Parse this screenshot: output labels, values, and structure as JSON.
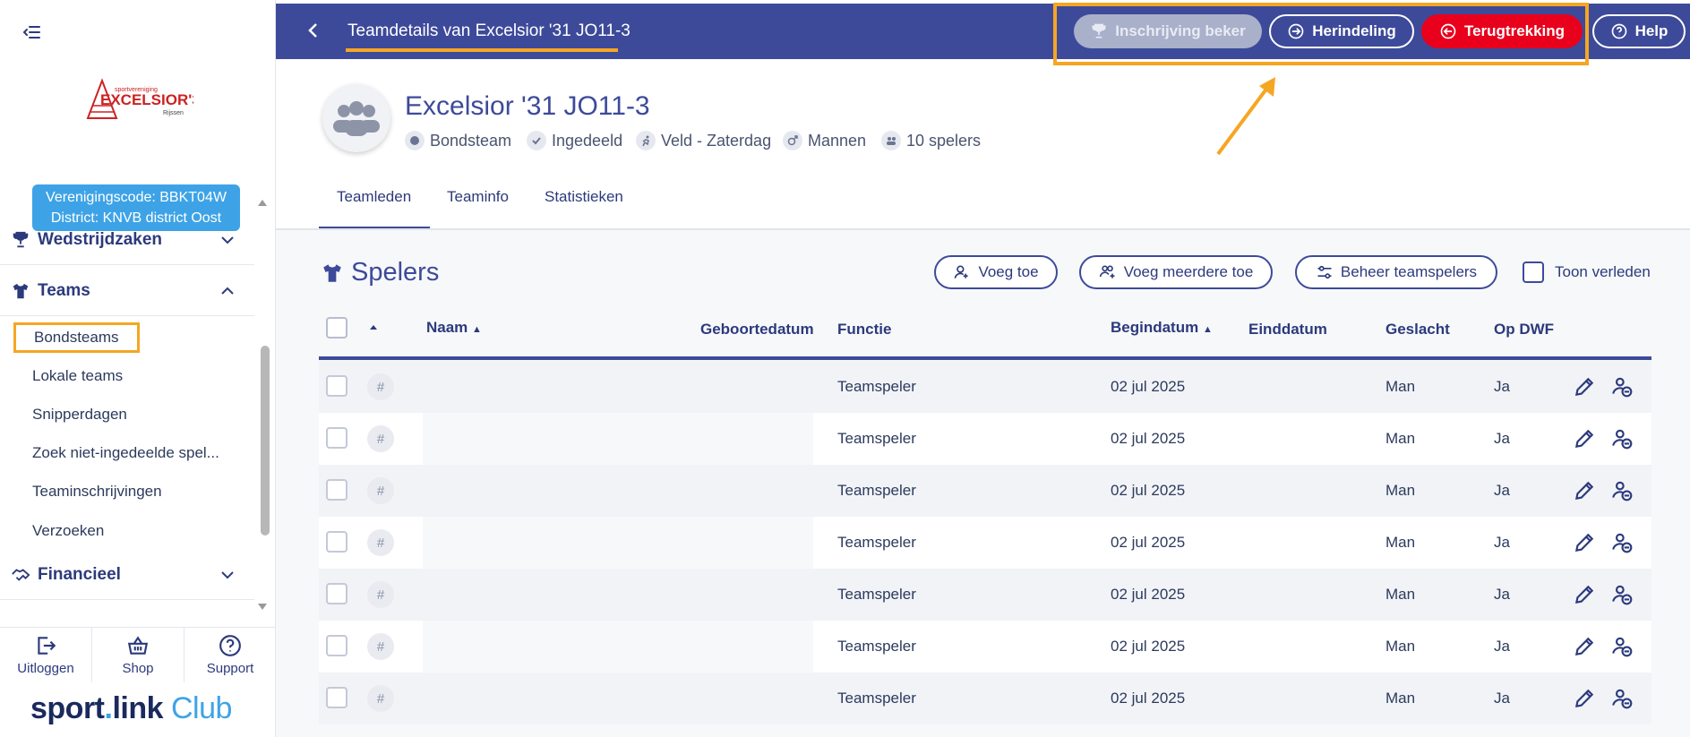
{
  "sidebar": {
    "club_code": "Verenigingscode: BBKT04W",
    "club_district": "District: KNVB district Oost",
    "logo_text": "EXCELSIOR'31",
    "sections": [
      {
        "label": "Wedstrijdzaken",
        "icon": "trophy-icon",
        "expanded": false
      },
      {
        "label": "Teams",
        "icon": "shirt-icon",
        "expanded": true
      },
      {
        "label": "Financieel",
        "icon": "handshake-icon",
        "expanded": false
      }
    ],
    "team_items": [
      "Bondsteams",
      "Lokale teams",
      "Snipperdagen",
      "Zoek niet-ingedeelde spel...",
      "Teaminschrijvingen",
      "Verzoeken"
    ],
    "active_item": "Bondsteams",
    "bottom": {
      "logout": "Uitloggen",
      "shop": "Shop",
      "support": "Support"
    },
    "brand": {
      "sport": "sport",
      "dot": ".",
      "link": "link",
      "club": "Club"
    }
  },
  "header": {
    "title": "Teamdetails van Excelsior '31 JO11-3",
    "buttons": {
      "beker": "Inschrijving beker",
      "herindeling": "Herindeling",
      "terugtrekking": "Terugtrekking",
      "help": "Help"
    }
  },
  "team": {
    "name": "Excelsior '31 JO11-3",
    "meta": [
      "Bondsteam",
      "Ingedeeld",
      "Veld - Zaterdag",
      "Mannen",
      "10 spelers"
    ]
  },
  "tabs": [
    "Teamleden",
    "Teaminfo",
    "Statistieken"
  ],
  "spelers": {
    "title": "Spelers",
    "add": "Voeg toe",
    "add_multiple": "Voeg meerdere toe",
    "manage": "Beheer teamspelers",
    "toon_verleden": "Toon verleden"
  },
  "table": {
    "columns": [
      "Naam",
      "Geboortedatum",
      "Functie",
      "Begindatum",
      "Einddatum",
      "Geslacht",
      "Op DWF"
    ],
    "rows": [
      {
        "hash": "#",
        "functie": "Teamspeler",
        "begindatum": "02 jul 2025",
        "einddatum": "",
        "geslacht": "Man",
        "dwf": "Ja"
      },
      {
        "hash": "#",
        "functie": "Teamspeler",
        "begindatum": "02 jul 2025",
        "einddatum": "",
        "geslacht": "Man",
        "dwf": "Ja"
      },
      {
        "hash": "#",
        "functie": "Teamspeler",
        "begindatum": "02 jul 2025",
        "einddatum": "",
        "geslacht": "Man",
        "dwf": "Ja"
      },
      {
        "hash": "#",
        "functie": "Teamspeler",
        "begindatum": "02 jul 2025",
        "einddatum": "",
        "geslacht": "Man",
        "dwf": "Ja"
      },
      {
        "hash": "#",
        "functie": "Teamspeler",
        "begindatum": "02 jul 2025",
        "einddatum": "",
        "geslacht": "Man",
        "dwf": "Ja"
      },
      {
        "hash": "#",
        "functie": "Teamspeler",
        "begindatum": "02 jul 2025",
        "einddatum": "",
        "geslacht": "Man",
        "dwf": "Ja"
      },
      {
        "hash": "#",
        "functie": "Teamspeler",
        "begindatum": "02 jul 2025",
        "einddatum": "",
        "geslacht": "Man",
        "dwf": "Ja"
      }
    ]
  },
  "colors": {
    "primary": "#3d4a9a",
    "accent": "#f5a623",
    "danger": "#e8001c",
    "info": "#3ea3e6"
  }
}
